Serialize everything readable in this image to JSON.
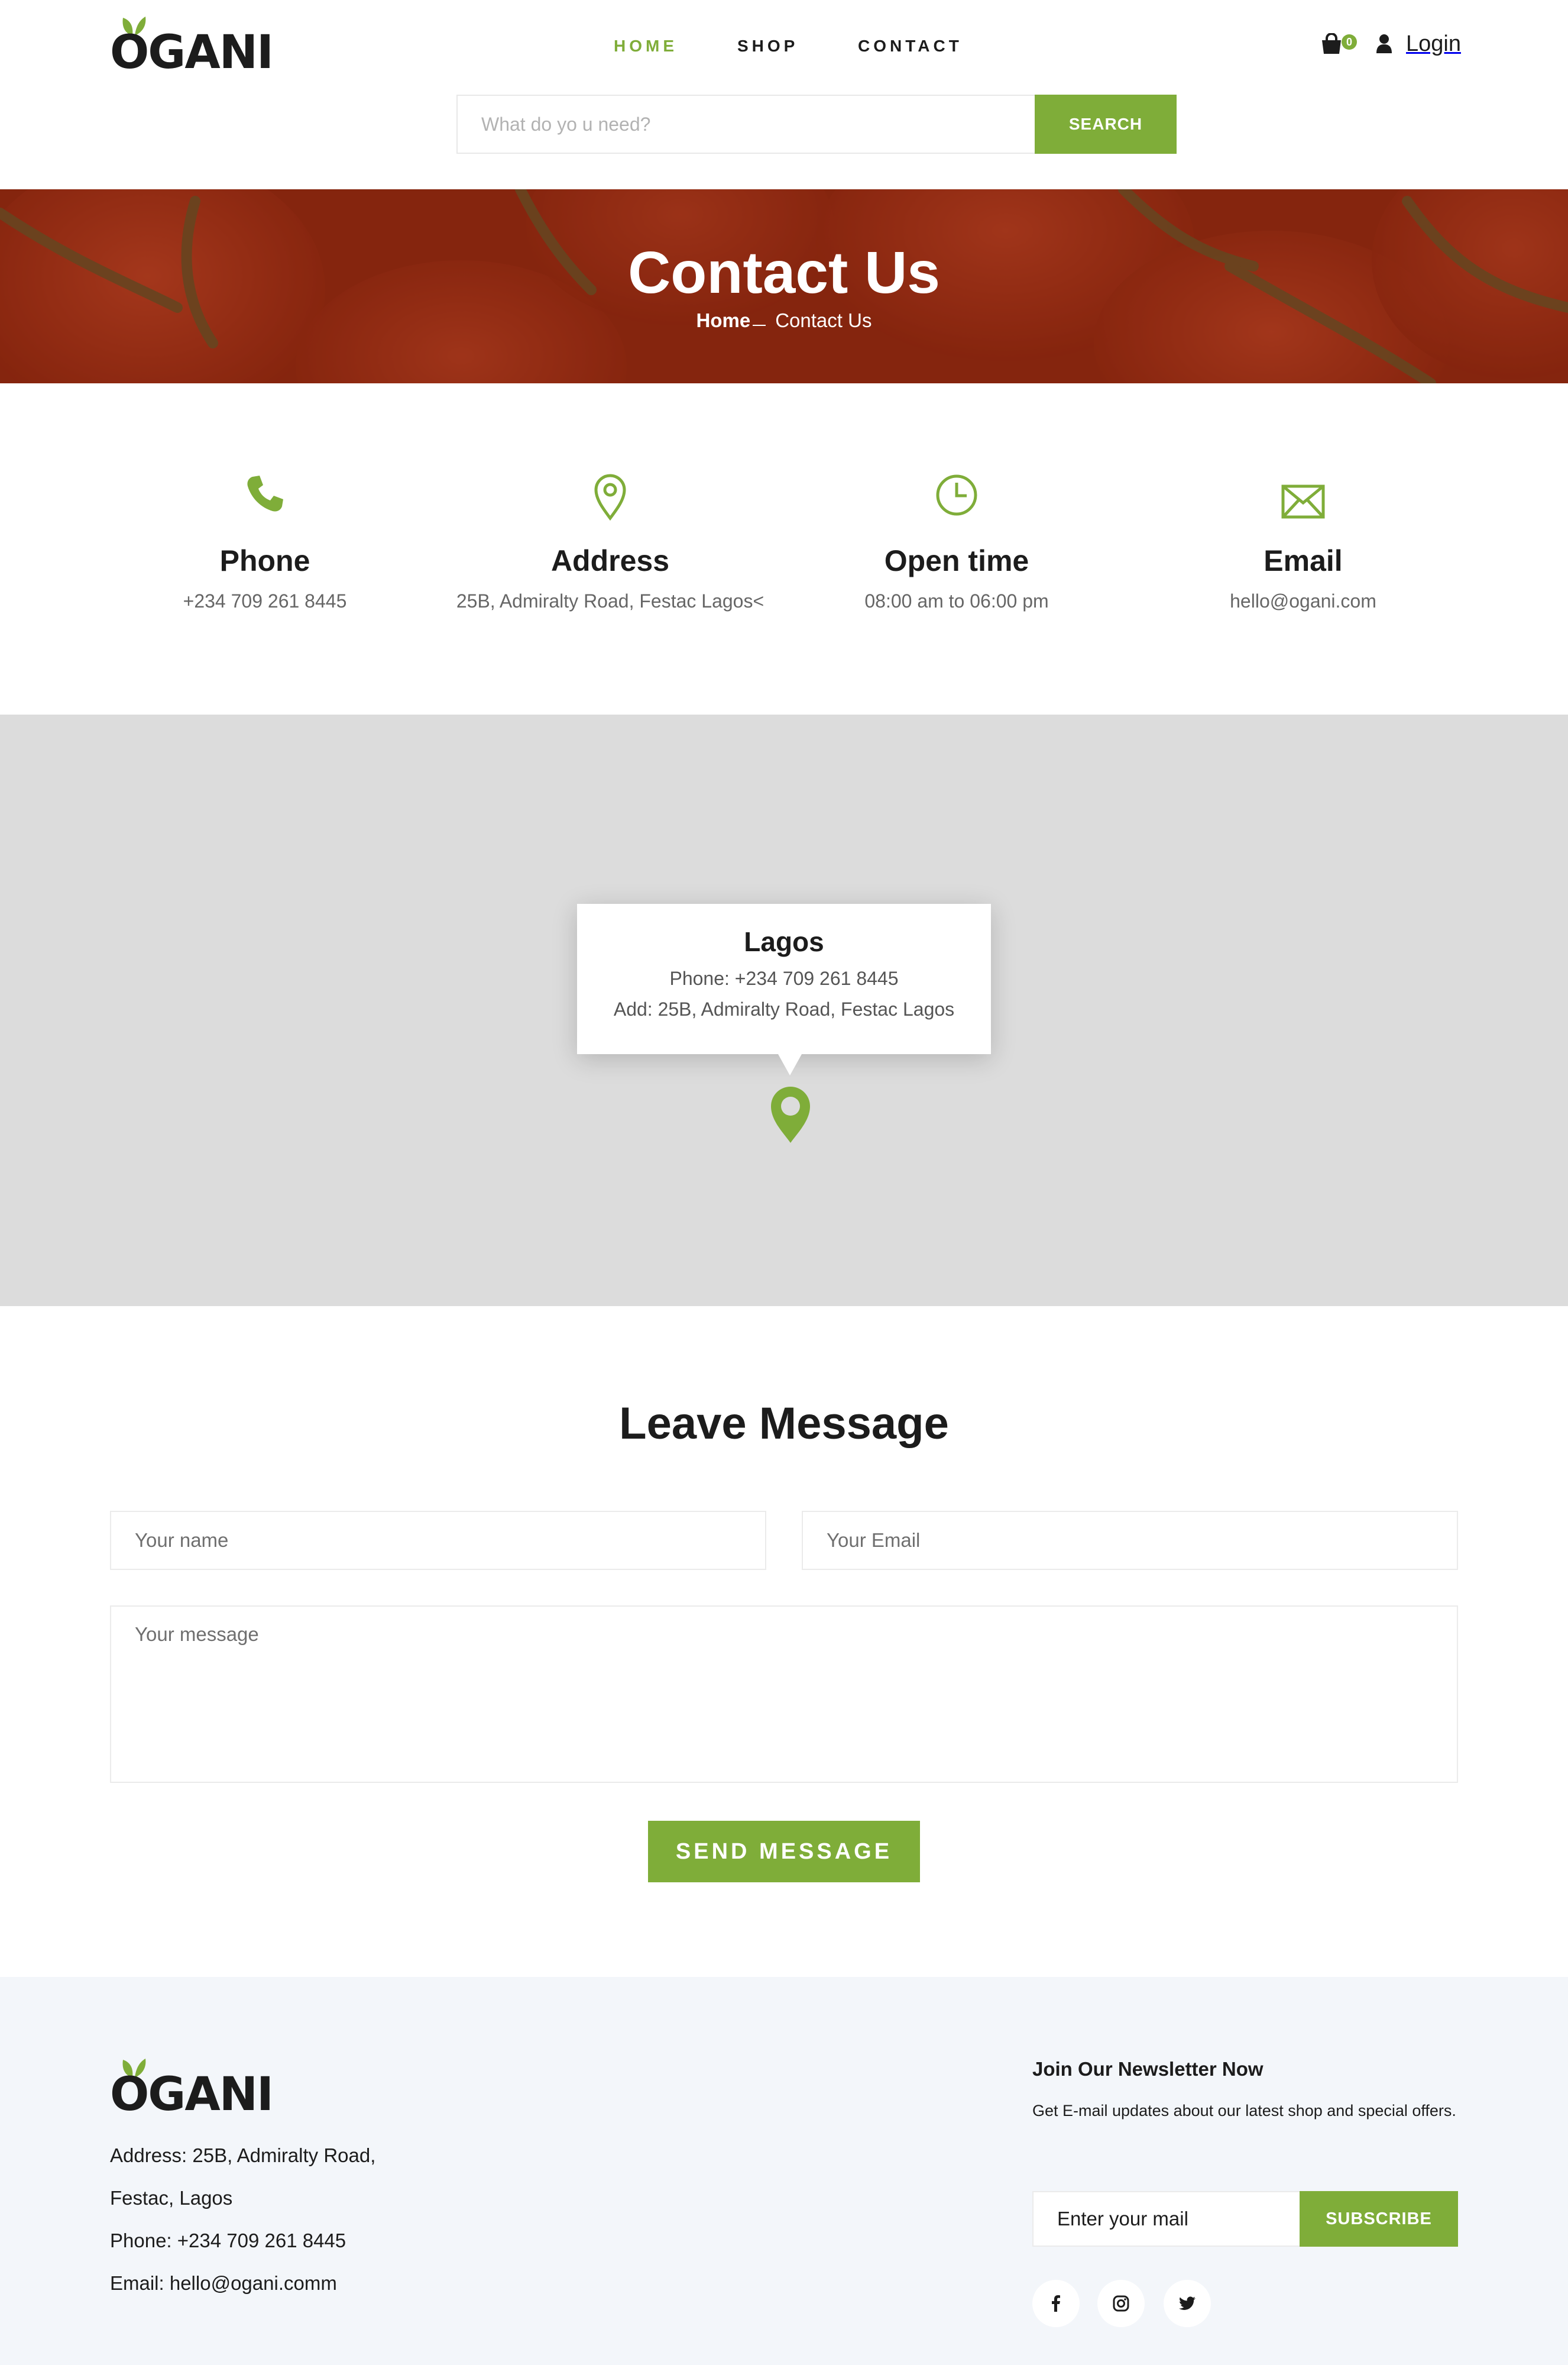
{
  "brand": {
    "name": "OGANI",
    "accent_color": "#7fad39",
    "text_color": "#1c1c1c"
  },
  "nav": {
    "items": [
      {
        "label": "HOME",
        "active": true
      },
      {
        "label": "SHOP",
        "active": false
      },
      {
        "label": "CONTACT",
        "active": false
      }
    ]
  },
  "header": {
    "cart_icon": "shopping-bag-icon",
    "cart_count": "0",
    "login_icon": "user-icon",
    "login_label": "Login"
  },
  "search": {
    "placeholder": "What do yo u need?",
    "button_label": "SEARCH"
  },
  "banner": {
    "title": "Contact Us",
    "breadcrumb": {
      "home": "Home",
      "current": "Contact Us"
    }
  },
  "contact_info": [
    {
      "icon": "phone-icon",
      "title": "Phone",
      "value": "+234 709 261 8445"
    },
    {
      "icon": "map-pin-icon",
      "title": "Address",
      "value": "25B, Admiralty Road, Festac Lagos<"
    },
    {
      "icon": "clock-icon",
      "title": "Open time",
      "value": "08:00 am to 06:00 pm"
    },
    {
      "icon": "envelope-icon",
      "title": "Email",
      "value": "hello@ogani.com"
    }
  ],
  "map": {
    "popup_title": "Lagos",
    "popup_phone": "Phone: +234 709 261 8445",
    "popup_address": "Add: 25B, Admiralty Road, Festac Lagos",
    "marker_icon": "map-marker-icon",
    "background_color": "#dcdcdc"
  },
  "message_form": {
    "title": "Leave Message",
    "name_placeholder": "Your name",
    "email_placeholder": "Your Email",
    "message_placeholder": "Your message",
    "submit_label": "SEND MESSAGE"
  },
  "footer": {
    "address_line1": "Address: 25B, Admiralty Road,",
    "address_line2": "Festac, Lagos",
    "phone": "Phone: +234 709 261 8445",
    "email": "Email: hello@ogani.comm",
    "newsletter": {
      "title": "Join Our Newsletter Now",
      "text": "Get E-mail updates about our latest shop and special offers.",
      "placeholder": "Enter your mail",
      "button_label": "SUBSCRIBE"
    },
    "social": [
      "facebook-icon",
      "instagram-icon",
      "twitter-icon"
    ]
  }
}
